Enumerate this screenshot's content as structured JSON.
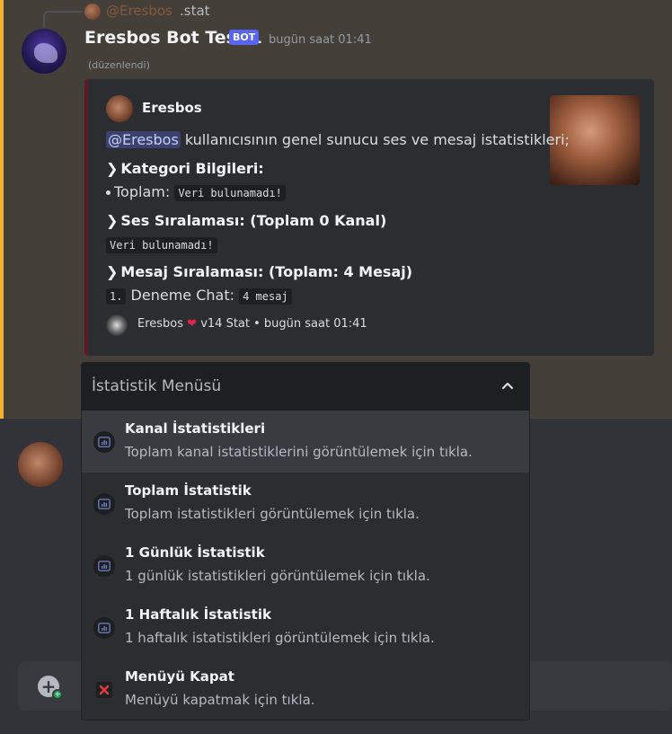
{
  "reply": {
    "mention": "@Eresbos",
    "command": ".stat"
  },
  "message": {
    "author": "Eresbos Bot Test 1",
    "bot_tag": "BOT",
    "timestamp": "bugün saat 01:41",
    "edited": "(düzenlendi)"
  },
  "embed": {
    "author": "Eresbos",
    "intro_mention": "@Eresbos",
    "intro_text": " kullanıcısının genel sunucu ses ve mesaj istatistikleri;",
    "category_header": "Kategori Bilgileri:",
    "total_label": "Toplam: ",
    "total_value": "Veri bulunamadı!",
    "voice_header": "Ses Sıralaması: (Toplam 0 Kanal)",
    "voice_value": "Veri bulunamadı!",
    "message_header": "Mesaj Sıralaması: (Toplam: 4 Mesaj)",
    "rank_number": "1.",
    "rank_channel": " Deneme Chat: ",
    "rank_value": "4 mesaj",
    "footer_name": "Eresbos",
    "footer_heart": "❤",
    "footer_rest": " v14 Stat • bugün saat 01:41"
  },
  "select_menu": {
    "placeholder": "İstatistik Menüsü",
    "options": [
      {
        "title": "Kanal İstatistikleri",
        "description": "Toplam kanal istatistiklerini görüntülemek için tıkla.",
        "icon": "chart-icon"
      },
      {
        "title": "Toplam İstatistik",
        "description": "Toplam istatistikleri görüntülemek için tıkla.",
        "icon": "chart-icon"
      },
      {
        "title": "1 Günlük İstatistik",
        "description": "1 günlük istatistikleri görüntülemek için tıkla.",
        "icon": "chart-icon"
      },
      {
        "title": "1 Haftalık İstatistik",
        "description": "1 haftalık istatistikleri görüntülemek için tıkla.",
        "icon": "chart-icon"
      },
      {
        "title": "Menüyü Kapat",
        "description": "Menüyü kapatmak için tıkla.",
        "icon": "close-x-icon"
      }
    ]
  },
  "colors": {
    "mention_highlight_bar": "#f0b232",
    "embed_border": "#5c1a24",
    "bot_tag": "#5865f2",
    "close_x": "#e03b3b"
  }
}
